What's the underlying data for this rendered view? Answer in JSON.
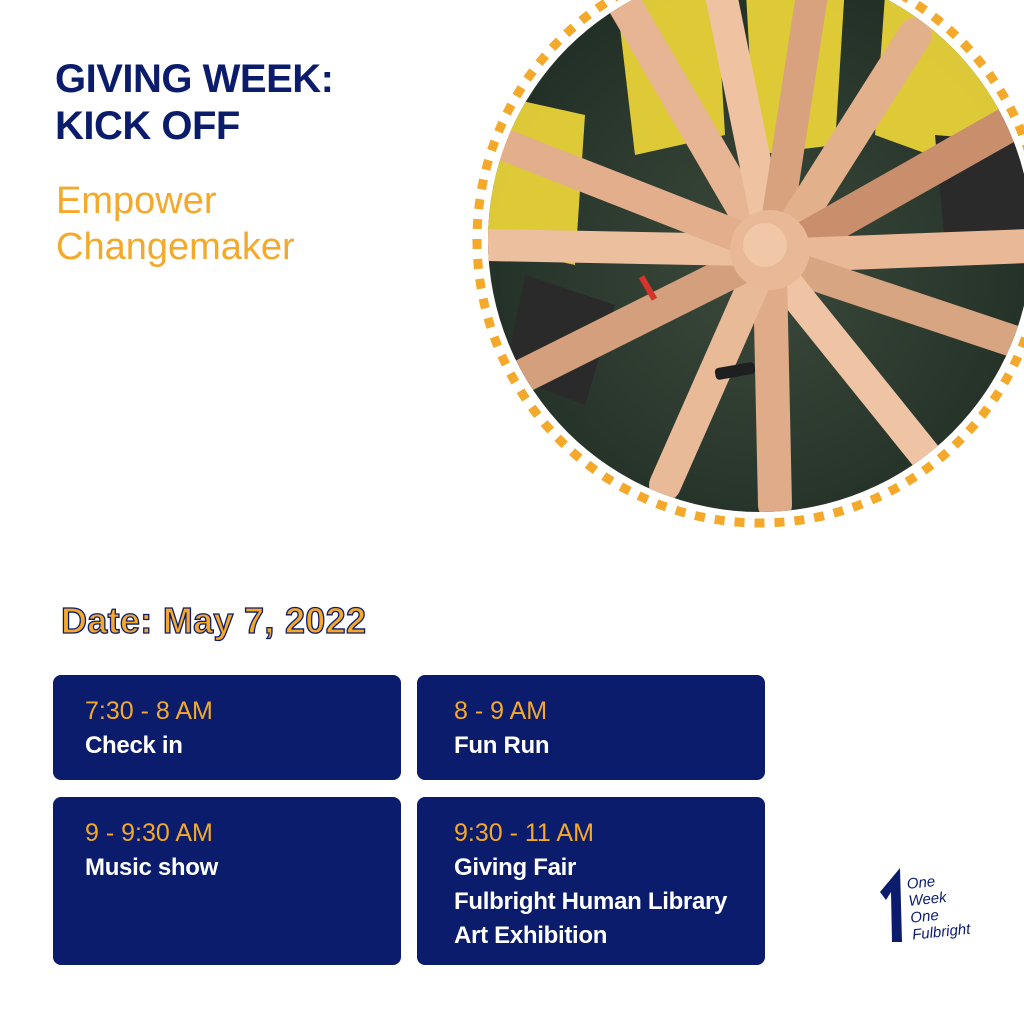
{
  "title": {
    "line1": "GIVING WEEK:",
    "line2": "KICK OFF"
  },
  "subtitle": {
    "line1": "Empower",
    "line2": "Changemaker"
  },
  "photo": {
    "subject": "group-hands-together-photo",
    "ring_color": "#f4a92a"
  },
  "date_label": "Date: May 7, 2022",
  "schedule": [
    {
      "time": "7:30 - 8 AM",
      "activities": [
        "Check in"
      ]
    },
    {
      "time": "8 - 9 AM",
      "activities": [
        "Fun Run"
      ]
    },
    {
      "time": "9 - 9:30 AM",
      "activities": [
        "Music show"
      ]
    },
    {
      "time": "9:30 - 11 AM",
      "activities": [
        "Giving Fair",
        "Fulbright Human Library",
        "Art Exhibition"
      ]
    }
  ],
  "logo": {
    "lines": [
      "One",
      "Week",
      "One",
      "Fulbright"
    ]
  },
  "colors": {
    "navy": "#0a1c6b",
    "accent": "#f4a92a",
    "background": "#ffffff"
  }
}
